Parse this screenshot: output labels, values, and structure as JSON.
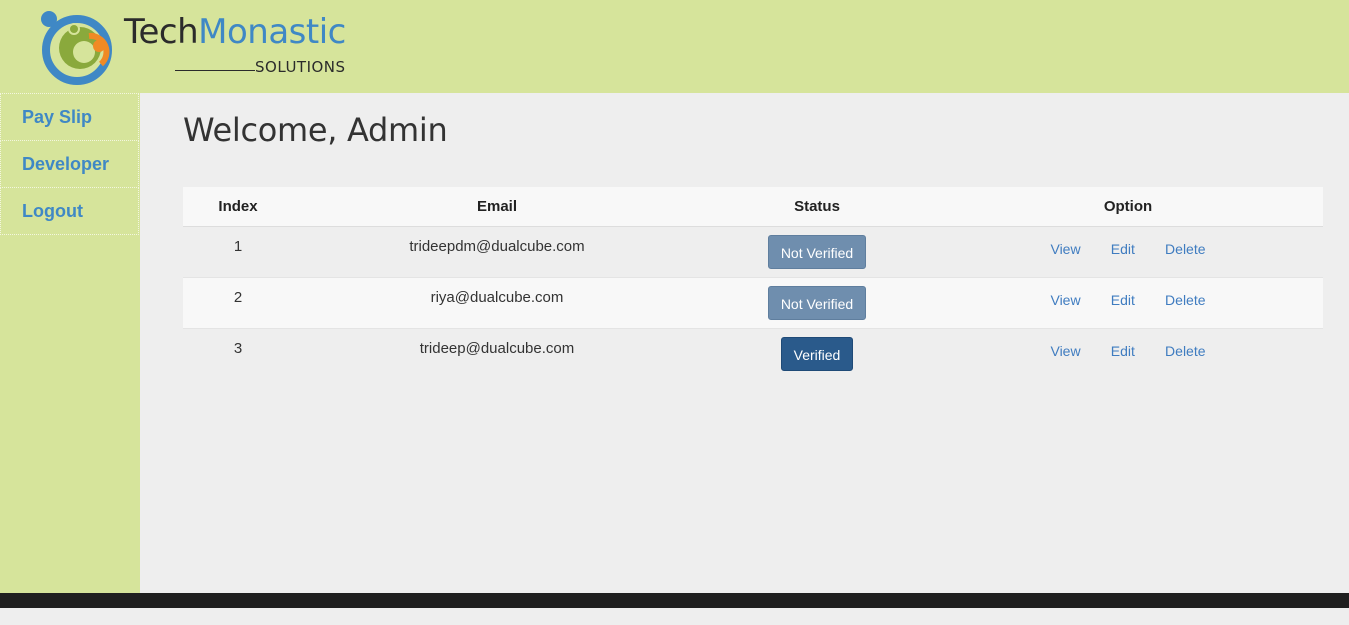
{
  "brand": {
    "name_part1": "Tech",
    "name_part2": "Monastic",
    "sub": "SOLUTIONS",
    "colors": {
      "dark": "#2b2b2b",
      "blue": "#3f88c5",
      "green": "#8aa93c",
      "orange": "#f08a24",
      "header_bg": "#d6e49b"
    }
  },
  "sidebar": {
    "items": [
      {
        "label": "Pay Slip"
      },
      {
        "label": "Developer"
      },
      {
        "label": "Logout"
      }
    ]
  },
  "main": {
    "welcome": "Welcome, Admin"
  },
  "table": {
    "headers": [
      "Index",
      "Email",
      "Status",
      "Option"
    ],
    "rows": [
      {
        "index": "1",
        "email": "trideepdm@dualcube.com",
        "status": "Not Verified",
        "options": [
          "View",
          "Edit",
          "Delete"
        ]
      },
      {
        "index": "2",
        "email": "riya@dualcube.com",
        "status": "Not Verified",
        "options": [
          "View",
          "Edit",
          "Delete"
        ]
      },
      {
        "index": "3",
        "email": "trideep@dualcube.com",
        "status": "Verified",
        "options": [
          "View",
          "Edit",
          "Delete"
        ]
      }
    ]
  },
  "colors": {
    "not_verified": "#6f8eae",
    "verified": "#2a5a8b",
    "link": "#3f7cc0",
    "footer": "#1f1f1f"
  }
}
